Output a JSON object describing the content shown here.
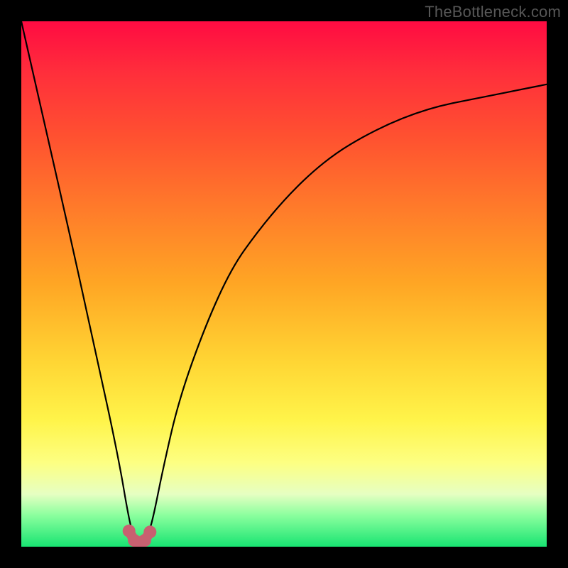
{
  "watermark": "TheBottleneck.com",
  "chart_data": {
    "type": "line",
    "title": "",
    "xlabel": "",
    "ylabel": "",
    "xlim": [
      0,
      100
    ],
    "ylim": [
      0,
      100
    ],
    "x": [
      0,
      5,
      10,
      15,
      17,
      19,
      20,
      21,
      22,
      23,
      24,
      25,
      27,
      30,
      35,
      40,
      45,
      50,
      55,
      60,
      65,
      70,
      75,
      80,
      85,
      90,
      95,
      100
    ],
    "values": [
      100,
      78,
      56,
      33,
      24,
      14,
      8,
      3,
      1,
      1,
      2,
      5,
      15,
      28,
      42,
      53,
      60,
      66,
      71,
      75,
      78,
      80.5,
      82.5,
      84,
      85,
      86,
      87,
      88
    ],
    "min_x": 22.5,
    "markers_x": [
      20.5,
      21.5,
      22.5,
      23.5,
      24.5
    ],
    "markers_y": [
      3,
      1.2,
      0.8,
      1.2,
      2.8
    ],
    "marker_color": "#c86070",
    "curve_color": "#000000",
    "gradient": [
      "#ff0b42",
      "#ffd634",
      "#fdff82",
      "#18e472"
    ]
  }
}
